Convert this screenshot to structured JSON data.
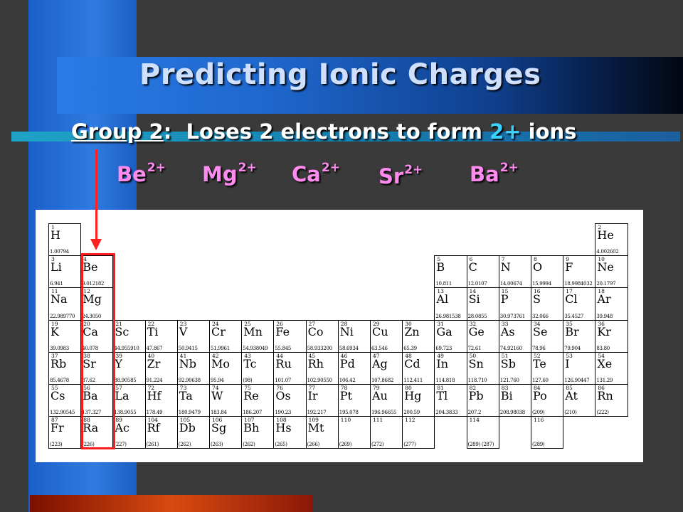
{
  "slide": {
    "title": "Predicting Ionic Charges",
    "group_label": "Group 2",
    "colon_text": ":  Loses 2 electrons to form ",
    "charge_text": "2+",
    "tail_text": " ions",
    "ions": [
      {
        "symbol": "Be",
        "charge": "2+"
      },
      {
        "symbol": "Mg",
        "charge": "2+"
      },
      {
        "symbol": "Ca",
        "charge": "2+"
      },
      {
        "symbol": "Sr",
        "charge": "2+"
      },
      {
        "symbol": "Ba",
        "charge": "2+"
      }
    ],
    "colors": {
      "ion": "#ff8af0",
      "charge_highlight": "#3ad2ff",
      "arrow": "#ff2020"
    }
  },
  "periodic_table": {
    "elements": [
      {
        "n": "1",
        "s": "H",
        "m": "1.00794",
        "r": 1,
        "c": 1
      },
      {
        "n": "2",
        "s": "He",
        "m": "4.002602",
        "r": 1,
        "c": 18
      },
      {
        "n": "3",
        "s": "Li",
        "m": "6.941",
        "r": 2,
        "c": 1
      },
      {
        "n": "4",
        "s": "Be",
        "m": "9.012182",
        "r": 2,
        "c": 2
      },
      {
        "n": "5",
        "s": "B",
        "m": "10.811",
        "r": 2,
        "c": 13
      },
      {
        "n": "6",
        "s": "C",
        "m": "12.0107",
        "r": 2,
        "c": 14
      },
      {
        "n": "7",
        "s": "N",
        "m": "14.00674",
        "r": 2,
        "c": 15
      },
      {
        "n": "8",
        "s": "O",
        "m": "15.9994",
        "r": 2,
        "c": 16
      },
      {
        "n": "9",
        "s": "F",
        "m": "18.9984032",
        "r": 2,
        "c": 17
      },
      {
        "n": "10",
        "s": "Ne",
        "m": "20.1797",
        "r": 2,
        "c": 18
      },
      {
        "n": "11",
        "s": "Na",
        "m": "22.989770",
        "r": 3,
        "c": 1
      },
      {
        "n": "12",
        "s": "Mg",
        "m": "24.3050",
        "r": 3,
        "c": 2
      },
      {
        "n": "13",
        "s": "Al",
        "m": "26.981538",
        "r": 3,
        "c": 13
      },
      {
        "n": "14",
        "s": "Si",
        "m": "28.0855",
        "r": 3,
        "c": 14
      },
      {
        "n": "15",
        "s": "P",
        "m": "30.973761",
        "r": 3,
        "c": 15
      },
      {
        "n": "16",
        "s": "S",
        "m": "32.066",
        "r": 3,
        "c": 16
      },
      {
        "n": "17",
        "s": "Cl",
        "m": "35.4527",
        "r": 3,
        "c": 17
      },
      {
        "n": "18",
        "s": "Ar",
        "m": "39.948",
        "r": 3,
        "c": 18
      },
      {
        "n": "19",
        "s": "K",
        "m": "39.0983",
        "r": 4,
        "c": 1
      },
      {
        "n": "20",
        "s": "Ca",
        "m": "40.078",
        "r": 4,
        "c": 2
      },
      {
        "n": "21",
        "s": "Sc",
        "m": "44.955910",
        "r": 4,
        "c": 3
      },
      {
        "n": "22",
        "s": "Ti",
        "m": "47.867",
        "r": 4,
        "c": 4
      },
      {
        "n": "23",
        "s": "V",
        "m": "50.9415",
        "r": 4,
        "c": 5
      },
      {
        "n": "24",
        "s": "Cr",
        "m": "51.9961",
        "r": 4,
        "c": 6
      },
      {
        "n": "25",
        "s": "Mn",
        "m": "54.938049",
        "r": 4,
        "c": 7
      },
      {
        "n": "26",
        "s": "Fe",
        "m": "55.845",
        "r": 4,
        "c": 8
      },
      {
        "n": "27",
        "s": "Co",
        "m": "58.933200",
        "r": 4,
        "c": 9
      },
      {
        "n": "28",
        "s": "Ni",
        "m": "58.6934",
        "r": 4,
        "c": 10
      },
      {
        "n": "29",
        "s": "Cu",
        "m": "63.546",
        "r": 4,
        "c": 11
      },
      {
        "n": "30",
        "s": "Zn",
        "m": "65.39",
        "r": 4,
        "c": 12
      },
      {
        "n": "31",
        "s": "Ga",
        "m": "69.723",
        "r": 4,
        "c": 13
      },
      {
        "n": "32",
        "s": "Ge",
        "m": "72.61",
        "r": 4,
        "c": 14
      },
      {
        "n": "33",
        "s": "As",
        "m": "74.92160",
        "r": 4,
        "c": 15
      },
      {
        "n": "34",
        "s": "Se",
        "m": "78.96",
        "r": 4,
        "c": 16
      },
      {
        "n": "35",
        "s": "Br",
        "m": "79.904",
        "r": 4,
        "c": 17
      },
      {
        "n": "36",
        "s": "Kr",
        "m": "83.80",
        "r": 4,
        "c": 18
      },
      {
        "n": "37",
        "s": "Rb",
        "m": "85.4678",
        "r": 5,
        "c": 1
      },
      {
        "n": "38",
        "s": "Sr",
        "m": "87.62",
        "r": 5,
        "c": 2
      },
      {
        "n": "39",
        "s": "Y",
        "m": "88.90585",
        "r": 5,
        "c": 3
      },
      {
        "n": "40",
        "s": "Zr",
        "m": "91.224",
        "r": 5,
        "c": 4
      },
      {
        "n": "41",
        "s": "Nb",
        "m": "92.90638",
        "r": 5,
        "c": 5
      },
      {
        "n": "42",
        "s": "Mo",
        "m": "95.94",
        "r": 5,
        "c": 6
      },
      {
        "n": "43",
        "s": "Tc",
        "m": "(98)",
        "r": 5,
        "c": 7
      },
      {
        "n": "44",
        "s": "Ru",
        "m": "101.07",
        "r": 5,
        "c": 8
      },
      {
        "n": "45",
        "s": "Rh",
        "m": "102.90550",
        "r": 5,
        "c": 9
      },
      {
        "n": "46",
        "s": "Pd",
        "m": "106.42",
        "r": 5,
        "c": 10
      },
      {
        "n": "47",
        "s": "Ag",
        "m": "107.8682",
        "r": 5,
        "c": 11
      },
      {
        "n": "48",
        "s": "Cd",
        "m": "112.411",
        "r": 5,
        "c": 12
      },
      {
        "n": "49",
        "s": "In",
        "m": "114.818",
        "r": 5,
        "c": 13
      },
      {
        "n": "50",
        "s": "Sn",
        "m": "118.710",
        "r": 5,
        "c": 14
      },
      {
        "n": "51",
        "s": "Sb",
        "m": "121.760",
        "r": 5,
        "c": 15
      },
      {
        "n": "52",
        "s": "Te",
        "m": "127.60",
        "r": 5,
        "c": 16
      },
      {
        "n": "53",
        "s": "I",
        "m": "126.90447",
        "r": 5,
        "c": 17
      },
      {
        "n": "54",
        "s": "Xe",
        "m": "131.29",
        "r": 5,
        "c": 18
      },
      {
        "n": "55",
        "s": "Cs",
        "m": "132.90545",
        "r": 6,
        "c": 1
      },
      {
        "n": "56",
        "s": "Ba",
        "m": "137.327",
        "r": 6,
        "c": 2
      },
      {
        "n": "57",
        "s": "La",
        "m": "138.9055",
        "r": 6,
        "c": 3
      },
      {
        "n": "72",
        "s": "Hf",
        "m": "178.49",
        "r": 6,
        "c": 4
      },
      {
        "n": "73",
        "s": "Ta",
        "m": "180.9479",
        "r": 6,
        "c": 5
      },
      {
        "n": "74",
        "s": "W",
        "m": "183.84",
        "r": 6,
        "c": 6
      },
      {
        "n": "75",
        "s": "Re",
        "m": "186.207",
        "r": 6,
        "c": 7
      },
      {
        "n": "76",
        "s": "Os",
        "m": "190.23",
        "r": 6,
        "c": 8
      },
      {
        "n": "77",
        "s": "Ir",
        "m": "192.217",
        "r": 6,
        "c": 9
      },
      {
        "n": "78",
        "s": "Pt",
        "m": "195.078",
        "r": 6,
        "c": 10
      },
      {
        "n": "79",
        "s": "Au",
        "m": "196.96655",
        "r": 6,
        "c": 11
      },
      {
        "n": "80",
        "s": "Hg",
        "m": "200.59",
        "r": 6,
        "c": 12
      },
      {
        "n": "81",
        "s": "Tl",
        "m": "204.3833",
        "r": 6,
        "c": 13
      },
      {
        "n": "82",
        "s": "Pb",
        "m": "207.2",
        "r": 6,
        "c": 14
      },
      {
        "n": "83",
        "s": "Bi",
        "m": "208.98038",
        "r": 6,
        "c": 15
      },
      {
        "n": "84",
        "s": "Po",
        "m": "(209)",
        "r": 6,
        "c": 16
      },
      {
        "n": "85",
        "s": "At",
        "m": "(210)",
        "r": 6,
        "c": 17
      },
      {
        "n": "86",
        "s": "Rn",
        "m": "(222)",
        "r": 6,
        "c": 18
      },
      {
        "n": "87",
        "s": "Fr",
        "m": "(223)",
        "r": 7,
        "c": 1
      },
      {
        "n": "88",
        "s": "Ra",
        "m": "(226)",
        "r": 7,
        "c": 2
      },
      {
        "n": "89",
        "s": "Ac",
        "m": "(227)",
        "r": 7,
        "c": 3
      },
      {
        "n": "104",
        "s": "Rf",
        "m": "(261)",
        "r": 7,
        "c": 4
      },
      {
        "n": "105",
        "s": "Db",
        "m": "(262)",
        "r": 7,
        "c": 5
      },
      {
        "n": "106",
        "s": "Sg",
        "m": "(263)",
        "r": 7,
        "c": 6
      },
      {
        "n": "107",
        "s": "Bh",
        "m": "(262)",
        "r": 7,
        "c": 7
      },
      {
        "n": "108",
        "s": "Hs",
        "m": "(265)",
        "r": 7,
        "c": 8
      },
      {
        "n": "109",
        "s": "Mt",
        "m": "(266)",
        "r": 7,
        "c": 9
      },
      {
        "n": "110",
        "s": "",
        "m": "(269)",
        "r": 7,
        "c": 10
      },
      {
        "n": "111",
        "s": "",
        "m": "(272)",
        "r": 7,
        "c": 11
      },
      {
        "n": "112",
        "s": "",
        "m": "(277)",
        "r": 7,
        "c": 12
      },
      {
        "n": "114",
        "s": "",
        "m": "(289) (287)",
        "r": 7,
        "c": 14
      },
      {
        "n": "116",
        "s": "",
        "m": "(289)",
        "r": 7,
        "c": 16
      }
    ]
  }
}
